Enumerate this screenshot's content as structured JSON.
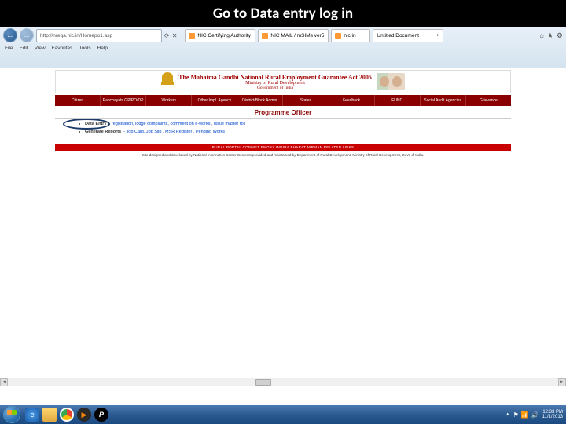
{
  "slide": {
    "title": "Go to Data entry log in"
  },
  "browser": {
    "tabs": [
      {
        "label": "NIC Certifying Authority"
      },
      {
        "label": "NIC MAIL / mSIMs ver5"
      },
      {
        "label": "nic.in"
      },
      {
        "label": "Untitled Document"
      }
    ],
    "tab_close": "×",
    "url": "http://nrega.nic.in/Homepo1.asp",
    "search_refresh": "⟳",
    "search_stop": "✕",
    "menus": [
      "File",
      "Edit",
      "View",
      "Favorites",
      "Tools",
      "Help"
    ],
    "nav": {
      "back": "←",
      "forward": "→"
    }
  },
  "page": {
    "banner": {
      "line1": "The Mahatma Gandhi National Rural Employment Guarantee Act 2005",
      "line2": "Ministry of Rural Development",
      "line3": "Government of India"
    },
    "nav_items": [
      "Citizen",
      "Panchayats GP/PO/DP",
      "Workers",
      "Other Impl. Agency",
      "District/Block Admin.",
      "States",
      "Feedback",
      "FUND",
      "Social Audit Agencies",
      "Grievance"
    ],
    "heading": "Programme Officer",
    "bullets": [
      {
        "prefix": "Data Entry",
        "link": "- registration, lodge complaints, comment on e-works , issue master roll"
      },
      {
        "prefix": "Generate Reports",
        "link": "- Job Card, Job Slip , MSR Register , Pending Works"
      }
    ],
    "red_strip": "RURAL PORTAL   COMMET   PMGSY   INDIRA   BHARAT NIRMAN   RELATED LINKS",
    "footer": "Site designed and developed by National Informatics Center Contents provided and maintained by Department of Rural Development, Ministry of Rural Development, Govt. of India."
  },
  "scroll": {
    "left": "◄",
    "right": "►"
  },
  "taskbar": {
    "tray_up": "▲",
    "time": "12:33 PM",
    "date": "11/1/2013"
  }
}
